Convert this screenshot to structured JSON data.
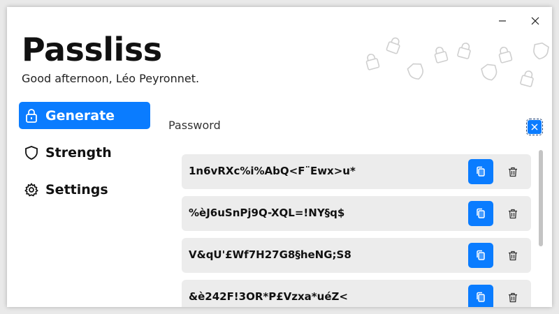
{
  "app": {
    "title": "Passliss",
    "greeting": "Good afternoon, Léo Peyronnet."
  },
  "window_controls": {
    "minimize_icon": "minimize-icon",
    "close_icon": "close-icon"
  },
  "nav": {
    "items": [
      {
        "label": "Generate",
        "icon": "lock-icon",
        "active": true
      },
      {
        "label": "Strength",
        "icon": "shield-icon",
        "active": false
      },
      {
        "label": "Settings",
        "icon": "gear-icon",
        "active": false
      }
    ]
  },
  "main": {
    "section_label": "Password",
    "passwords": [
      "1n6vRXc%i%AbQ<F¨Ewx>u*",
      "%èJ6uSnPj9Q-XQL=!NY§q$",
      "V&qU'£Wf7H27G8§heNG;S8",
      "&è242F!3OR*P£Vzxa*uéZ<"
    ]
  },
  "colors": {
    "accent": "#0a7cff",
    "row_bg": "#ececec",
    "text": "#111111"
  }
}
